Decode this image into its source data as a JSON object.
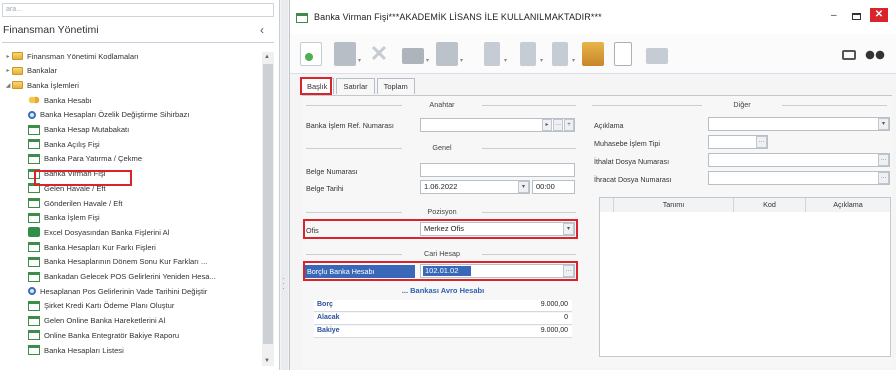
{
  "left_panel": {
    "search_placeholder": "ara...",
    "title": "Finansman Yönetimi",
    "collapse_icon": "chevron-left-icon",
    "tree": [
      {
        "label": "Finansman Yönetimi Kodlamaları",
        "type": "folder",
        "indent": 0,
        "expander": "▸"
      },
      {
        "label": "Bankalar",
        "type": "folder",
        "indent": 0,
        "expander": "▸"
      },
      {
        "label": "Banka İşlemleri",
        "type": "folder",
        "indent": 0,
        "expander": "◢"
      },
      {
        "label": "Banka Hesabı",
        "type": "coins",
        "indent": 1
      },
      {
        "label": "Banka Hesapları Özelik Değiştirme Sihirbazı",
        "type": "mag",
        "indent": 1
      },
      {
        "label": "Banka Hesap Mutabakatı",
        "type": "form",
        "indent": 1
      },
      {
        "label": "Banka Açılış Fişi",
        "type": "form",
        "indent": 1
      },
      {
        "label": "Banka Para Yatırma / Çekme",
        "type": "form",
        "indent": 1
      },
      {
        "label": "Banka Virman Fişi",
        "type": "form",
        "indent": 1
      },
      {
        "label": "Gelen Havale / Eft",
        "type": "form",
        "indent": 1
      },
      {
        "label": "Gönderilen Havale / Eft",
        "type": "form",
        "indent": 1
      },
      {
        "label": "Banka İşlem Fişi",
        "type": "form",
        "indent": 1
      },
      {
        "label": "Excel Dosyasından Banka Fişlerini Al",
        "type": "xl",
        "indent": 1
      },
      {
        "label": "Banka Hesapları Kur Farkı Fişleri",
        "type": "form",
        "indent": 1
      },
      {
        "label": "Banka Hesaplarının Dönem Sonu Kur Farkları ...",
        "type": "form",
        "indent": 1
      },
      {
        "label": "Bankadan Gelecek POS Gelirlerini Yeniden Hesa...",
        "type": "form",
        "indent": 1
      },
      {
        "label": "Hesaplanan Pos Gelirlerinin Vade Tarihini Değiştir",
        "type": "mag",
        "indent": 1
      },
      {
        "label": "Şirket Kredi Kartı Ödeme Planı Oluştur",
        "type": "form",
        "indent": 1
      },
      {
        "label": "Gelen Online Banka Hareketlerini Al",
        "type": "form",
        "indent": 1
      },
      {
        "label": "Online Banka Entegratör Bakiye Raporu",
        "type": "form",
        "indent": 1
      },
      {
        "label": "Banka Hesapları Listesi",
        "type": "form",
        "indent": 1
      }
    ]
  },
  "window": {
    "title": "Banka Virman Fişi***AKADEMİK LİSANS İLE KULLANILMAKTADIR***",
    "min": "–",
    "close": "✕",
    "toolbar_icons": [
      "new-icon",
      "save-icon",
      "delete-icon",
      "print-icon",
      "copy-icon",
      "first-icon",
      "prev-icon",
      "next-icon",
      "briefcase-icon",
      "document-icon",
      "folder-icon",
      "monitor-icon",
      "binoculars-icon"
    ],
    "tabs": [
      "Başlık",
      "Satırlar",
      "Toplam"
    ]
  },
  "form": {
    "anahtar": {
      "title": "Anahtar",
      "ref_label": "Banka İşlem Ref. Numarası",
      "ref_value": "",
      "btn1": "▸",
      "btn2": "···",
      "btn3": "+"
    },
    "genel": {
      "title": "Genel",
      "belge_no_label": "Belge Numarası",
      "belge_no_value": "",
      "belge_tarih_label": "Belge Tarihi",
      "belge_tarih_value": "1.06.2022",
      "saat_value": "00:00"
    },
    "pozisyon": {
      "title": "Pozisyon",
      "ofis_label": "Ofis",
      "ofis_value": "Merkez Ofis"
    },
    "cari": {
      "title": "Cari Hesap",
      "borclu_label": "Borçlu Banka Hesabı",
      "borclu_value": "102.01.02",
      "account_title": "... Bankası Avro Hesabı",
      "rows": [
        {
          "label": "Borç",
          "value": "9.000,00"
        },
        {
          "label": "Alacak",
          "value": "0"
        },
        {
          "label": "Bakiye",
          "value": "9.000,00"
        }
      ]
    },
    "diger": {
      "title": "Diğer",
      "aciklama_label": "Açıklama",
      "aciklama_value": "",
      "muh_label": "Muhasebe İşlem Tipi",
      "ithalat_label": "İthalat Dosya Numarası",
      "ihracat_label": "İhracat Dosya Numarası",
      "grid_headers": [
        "Tanımı",
        "Kod",
        "Açıklama"
      ]
    }
  },
  "colors": {
    "highlight": "#d9242b",
    "selection": "#3a68b8"
  }
}
